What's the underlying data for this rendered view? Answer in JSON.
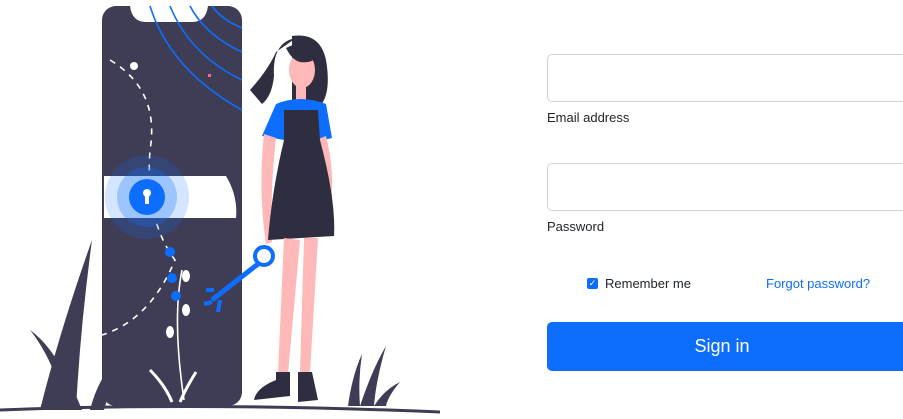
{
  "form": {
    "email": {
      "label": "Email address",
      "value": "",
      "placeholder": ""
    },
    "password": {
      "label": "Password",
      "value": "",
      "placeholder": ""
    },
    "remember": {
      "label": "Remember me",
      "checked": true,
      "icon": "checkmark-icon"
    },
    "forgot_label": "Forgot password?",
    "signin_label": "Sign in"
  },
  "colors": {
    "primary": "#0d6efd",
    "phone": "#3f3d56",
    "skin": "#ffb8b8",
    "hair": "#2f2e41",
    "shirt": "#0d6efd"
  }
}
